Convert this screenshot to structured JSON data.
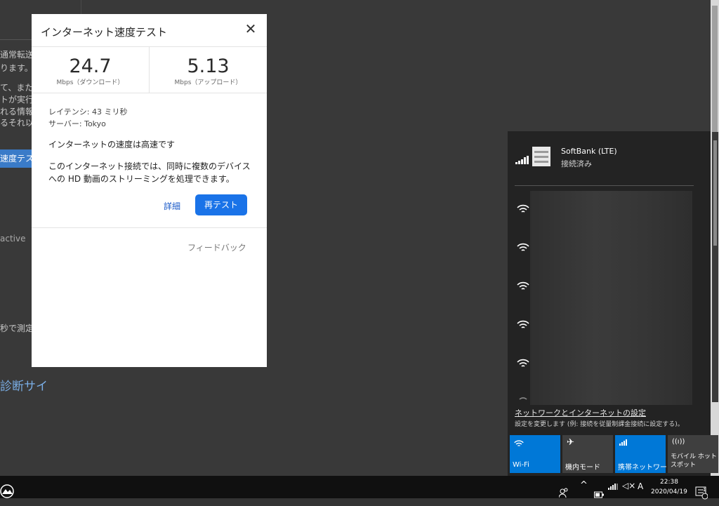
{
  "background": {
    "text_lines": [
      "通常転送",
      "ります。",
      "て、また、",
      "トが実行",
      "れる情報",
      "るそれ以"
    ],
    "button_fragment": "速度テス",
    "active_fragment": "active",
    "measure_fragment": "秒で測定",
    "heading_fragment": "診断サイ"
  },
  "speedtest": {
    "title": "インターネット速度テスト",
    "close_label": "✕",
    "download_value": "24.7",
    "download_unit": "Mbps（ダウンロード）",
    "upload_value": "5.13",
    "upload_unit": "Mbps（アップロード）",
    "latency": "レイテンシ: 43 ミリ秒",
    "server": "サーバー: Tokyo",
    "verdict": "インターネットの速度は高速です",
    "description_line1": "このインターネット接続では、同時に複数のデバイス",
    "description_line2": "への HD 動画のストリーミングを処理できます。",
    "details_link": "詳細",
    "retest_button": "再テスト",
    "feedback_link": "フィードバック"
  },
  "network_flyout": {
    "connection_name": "SoftBank (LTE)",
    "connection_status": "接続済み",
    "settings_link": "ネットワークとインターネットの設定",
    "settings_desc": "設定を変更します (例: 接続を従量制課金接続に設定する)。",
    "tiles": [
      {
        "label": "Wi-Fi",
        "icon": "wifi-icon",
        "active": true
      },
      {
        "label": "機内モード",
        "icon": "airplane-icon",
        "active": false
      },
      {
        "label": "携帯ネットワーク",
        "icon": "cellular-icon",
        "active": true
      },
      {
        "label": "モバイル ホットスポット",
        "icon": "hotspot-icon",
        "active": false
      }
    ],
    "colors": {
      "active_tile": "#0078d7",
      "inactive_tile": "#3f3f3f",
      "flyout_bg": "#232323"
    }
  },
  "taskbar": {
    "time": "22:38",
    "date": "2020/04/19",
    "ime_indicator": "A",
    "notification_count": "1"
  }
}
